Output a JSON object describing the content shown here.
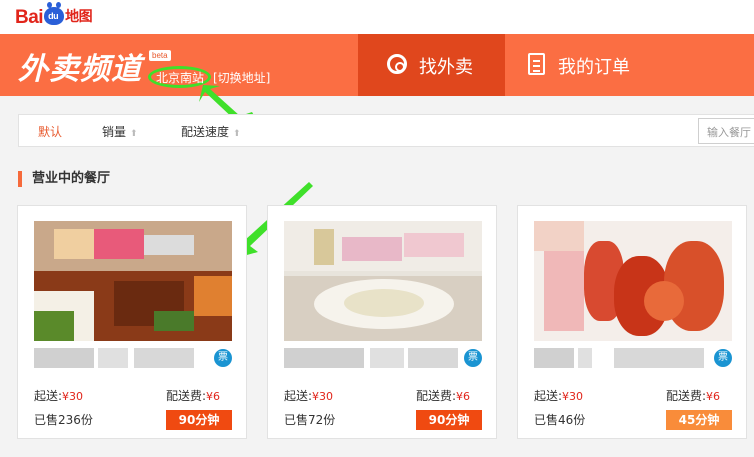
{
  "logo": {
    "text_bai": "Bai",
    "text_du": "du",
    "text_map": "地图"
  },
  "header": {
    "brand": "外卖频道",
    "beta": "beta",
    "location": "北京南站",
    "switch_address": "[切换地址]",
    "nav_find": "找外卖",
    "nav_orders": "我的订单"
  },
  "sort": {
    "default": "默认",
    "sales": "销量",
    "speed": "配送速度",
    "arrow": "⬆",
    "search_placeholder": "输入餐厅"
  },
  "section_title": "营业中的餐厅",
  "restaurants": [
    {
      "min_label": "起送:",
      "min_price": "¥30",
      "fee_label": "配送费:",
      "fee": "¥6",
      "sold": "已售236份",
      "time": "90分钟",
      "ticket": "票"
    },
    {
      "min_label": "起送:",
      "min_price": "¥30",
      "fee_label": "配送费:",
      "fee": "¥6",
      "sold": "已售72份",
      "time": "90分钟",
      "ticket": "票"
    },
    {
      "min_label": "起送:",
      "min_price": "¥30",
      "fee_label": "配送费:",
      "fee": "¥6",
      "sold": "已售46份",
      "time": "45分钟",
      "ticket": "票"
    }
  ],
  "colors": {
    "header": "#fb6e43",
    "nav_active": "#e0471d",
    "time_badge": "#f04a11",
    "time_badge_light": "#f98c3a",
    "annotation_arrow": "#3fe02a"
  }
}
